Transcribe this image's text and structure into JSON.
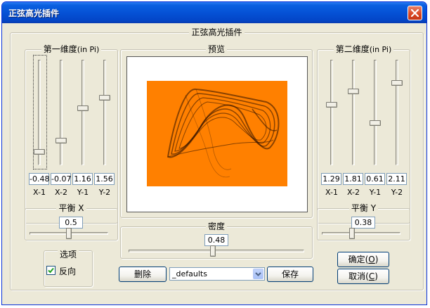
{
  "window": {
    "title": "正弦高光插件",
    "close_label": "close"
  },
  "main_group": {
    "label": "正弦高光插件"
  },
  "dim1": {
    "label": "第一维度",
    "unit": "(in Pi)",
    "sliders": [
      {
        "axis": "X-1",
        "value": "-0.48",
        "level": -0.48
      },
      {
        "axis": "X-2",
        "value": "-0.07",
        "level": -0.07
      },
      {
        "axis": "Y-1",
        "value": "1.16",
        "level": 1.16
      },
      {
        "axis": "Y-2",
        "value": "1.56",
        "level": 1.56
      }
    ]
  },
  "dim2": {
    "label": "第二维度",
    "unit": "(in Pi)",
    "sliders": [
      {
        "axis": "X-1",
        "value": "1.29",
        "level": 1.29
      },
      {
        "axis": "X-2",
        "value": "1.81",
        "level": 1.81
      },
      {
        "axis": "Y-1",
        "value": "0.61",
        "level": 0.61
      },
      {
        "axis": "Y-2",
        "value": "2.11",
        "level": 2.11
      }
    ]
  },
  "preview": {
    "label": "预览",
    "background_color": "#ff8000"
  },
  "balance_x": {
    "label": "平衡 X",
    "value": "0.5",
    "level": 0.5
  },
  "balance_y": {
    "label": "平衡 Y",
    "value": "0.38",
    "level": 0.38
  },
  "density": {
    "label": "密度",
    "value": "0.48",
    "level": 0.48
  },
  "options": {
    "label": "选项",
    "reverse_label": "反向",
    "reverse_checked": true
  },
  "presets": {
    "delete_label": "删除",
    "selected": "_defaults",
    "save_label": "保存"
  },
  "actions": {
    "ok_label": "确定",
    "ok_key": "O",
    "cancel_label": "取消",
    "cancel_key": "C"
  },
  "colors": {
    "titlebar": "#0552d6",
    "dialog": "#ece9d8",
    "preview_bg": "#ff8000",
    "curve": "#2a0e00"
  }
}
